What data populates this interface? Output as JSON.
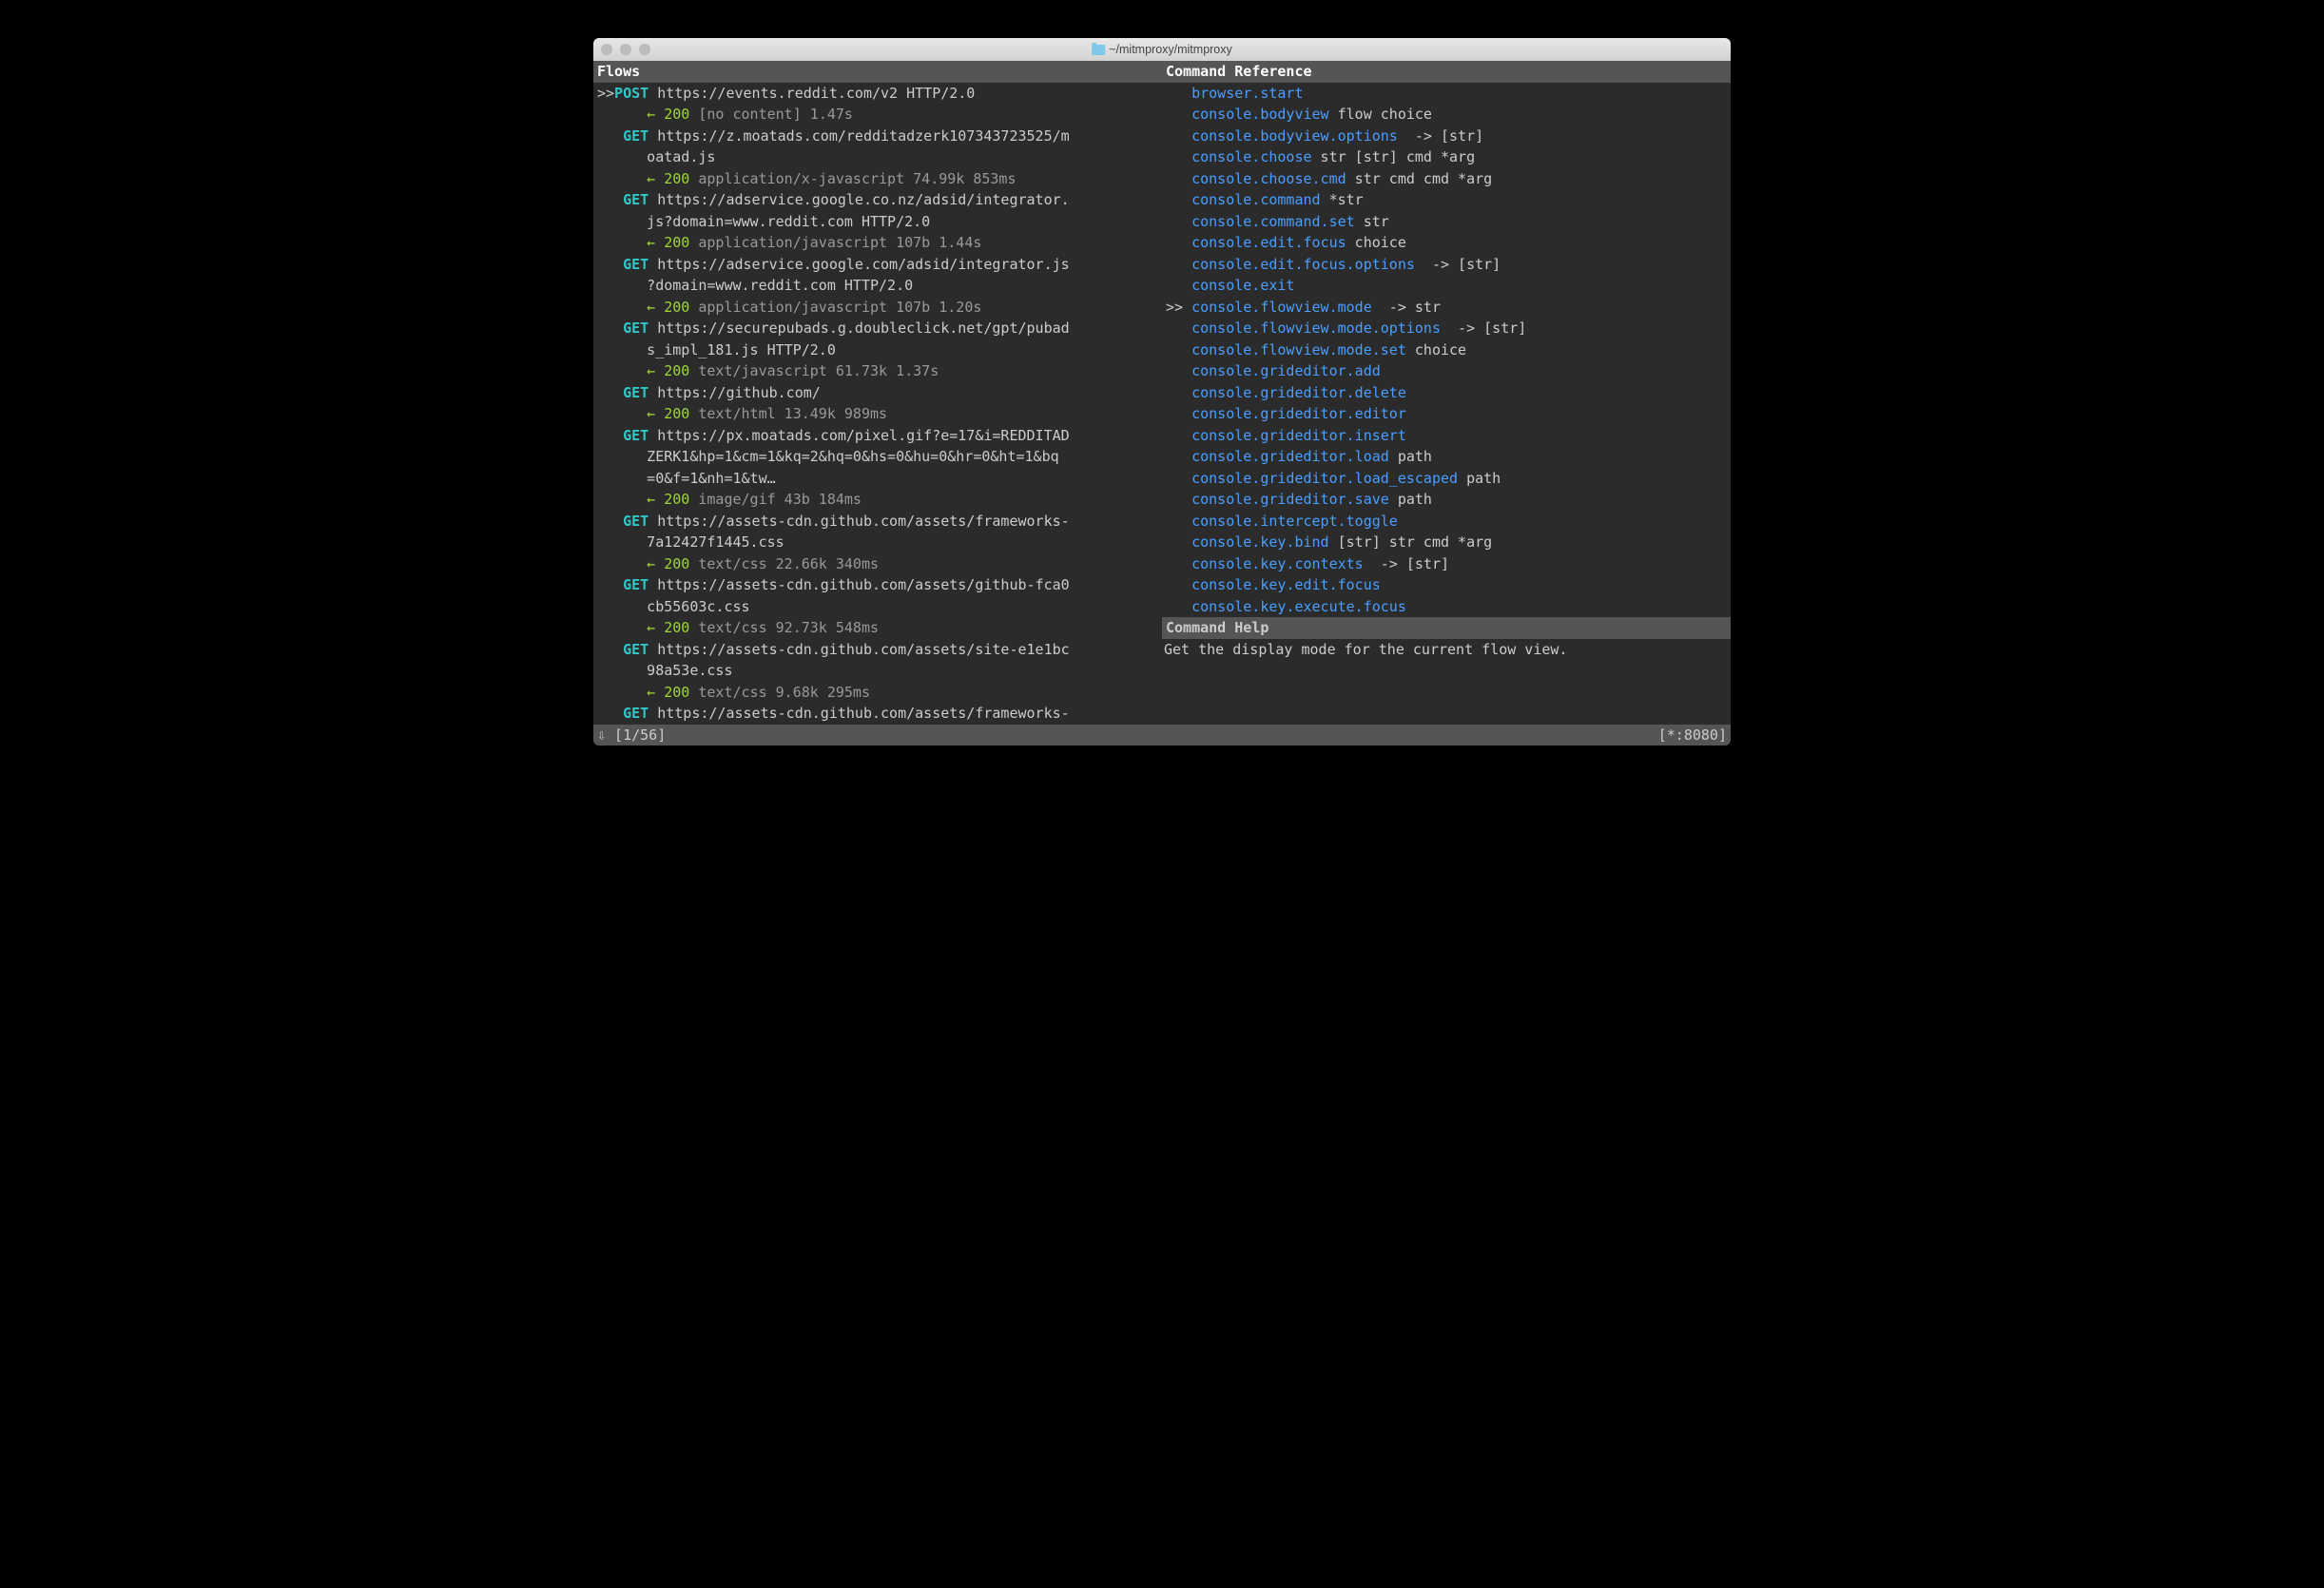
{
  "window": {
    "title": "~/mitmproxy/mitmproxy"
  },
  "panes": {
    "flows_header": "Flows",
    "commands_header": "Command Reference",
    "help_header": "Command Help",
    "help_text": "Get the display mode for the current flow view."
  },
  "flows": [
    {
      "selected": true,
      "method": "POST",
      "url": "https://events.reddit.com/v2 HTTP/2.0",
      "url_cont": [],
      "status": "200",
      "resp": "[no content] 1.47s"
    },
    {
      "selected": false,
      "method": "GET",
      "url": "https://z.moatads.com/redditadzerk107343723525/m",
      "url_cont": [
        "oatad.js"
      ],
      "status": "200",
      "resp": "application/x-javascript 74.99k 853ms"
    },
    {
      "selected": false,
      "method": "GET",
      "url": "https://adservice.google.co.nz/adsid/integrator.",
      "url_cont": [
        "js?domain=www.reddit.com HTTP/2.0"
      ],
      "status": "200",
      "resp": "application/javascript 107b 1.44s"
    },
    {
      "selected": false,
      "method": "GET",
      "url": "https://adservice.google.com/adsid/integrator.js",
      "url_cont": [
        "?domain=www.reddit.com HTTP/2.0"
      ],
      "status": "200",
      "resp": "application/javascript 107b 1.20s"
    },
    {
      "selected": false,
      "method": "GET",
      "url": "https://securepubads.g.doubleclick.net/gpt/pubad",
      "url_cont": [
        "s_impl_181.js HTTP/2.0"
      ],
      "status": "200",
      "resp": "text/javascript 61.73k 1.37s"
    },
    {
      "selected": false,
      "method": "GET",
      "url": "https://github.com/",
      "url_cont": [],
      "status": "200",
      "resp": "text/html 13.49k 989ms"
    },
    {
      "selected": false,
      "method": "GET",
      "url": "https://px.moatads.com/pixel.gif?e=17&i=REDDITAD",
      "url_cont": [
        "ZERK1&hp=1&cm=1&kq=2&hq=0&hs=0&hu=0&hr=0&ht=1&bq",
        "=0&f=1&nh=1&tw…"
      ],
      "status": "200",
      "resp": "image/gif 43b 184ms"
    },
    {
      "selected": false,
      "method": "GET",
      "url": "https://assets-cdn.github.com/assets/frameworks-",
      "url_cont": [
        "7a12427f1445.css"
      ],
      "status": "200",
      "resp": "text/css 22.66k 340ms"
    },
    {
      "selected": false,
      "method": "GET",
      "url": "https://assets-cdn.github.com/assets/github-fca0",
      "url_cont": [
        "cb55603c.css"
      ],
      "status": "200",
      "resp": "text/css 92.73k 548ms"
    },
    {
      "selected": false,
      "method": "GET",
      "url": "https://assets-cdn.github.com/assets/site-e1e1bc",
      "url_cont": [
        "98a53e.css"
      ],
      "status": "200",
      "resp": "text/css 9.68k 295ms"
    },
    {
      "selected": false,
      "method": "GET",
      "url": "https://assets-cdn.github.com/assets/frameworks-",
      "url_cont": [],
      "status": "",
      "resp": ""
    }
  ],
  "commands": [
    {
      "selected": false,
      "name": "browser.start",
      "args": ""
    },
    {
      "selected": false,
      "name": "console.bodyview",
      "args": " flow choice"
    },
    {
      "selected": false,
      "name": "console.bodyview.options",
      "args": "  -> [str]"
    },
    {
      "selected": false,
      "name": "console.choose",
      "args": " str [str] cmd *arg"
    },
    {
      "selected": false,
      "name": "console.choose.cmd",
      "args": " str cmd cmd *arg"
    },
    {
      "selected": false,
      "name": "console.command",
      "args": " *str"
    },
    {
      "selected": false,
      "name": "console.command.set",
      "args": " str"
    },
    {
      "selected": false,
      "name": "console.edit.focus",
      "args": " choice"
    },
    {
      "selected": false,
      "name": "console.edit.focus.options",
      "args": "  -> [str]"
    },
    {
      "selected": false,
      "name": "console.exit",
      "args": ""
    },
    {
      "selected": true,
      "name": "console.flowview.mode",
      "args": "  -> str"
    },
    {
      "selected": false,
      "name": "console.flowview.mode.options",
      "args": "  -> [str]"
    },
    {
      "selected": false,
      "name": "console.flowview.mode.set",
      "args": " choice"
    },
    {
      "selected": false,
      "name": "console.grideditor.add",
      "args": ""
    },
    {
      "selected": false,
      "name": "console.grideditor.delete",
      "args": ""
    },
    {
      "selected": false,
      "name": "console.grideditor.editor",
      "args": ""
    },
    {
      "selected": false,
      "name": "console.grideditor.insert",
      "args": ""
    },
    {
      "selected": false,
      "name": "console.grideditor.load",
      "args": " path"
    },
    {
      "selected": false,
      "name": "console.grideditor.load_escaped",
      "args": " path"
    },
    {
      "selected": false,
      "name": "console.grideditor.save",
      "args": " path"
    },
    {
      "selected": false,
      "name": "console.intercept.toggle",
      "args": ""
    },
    {
      "selected": false,
      "name": "console.key.bind",
      "args": " [str] str cmd *arg"
    },
    {
      "selected": false,
      "name": "console.key.contexts",
      "args": "  -> [str]"
    },
    {
      "selected": false,
      "name": "console.key.edit.focus",
      "args": ""
    },
    {
      "selected": false,
      "name": "console.key.execute.focus",
      "args": ""
    }
  ],
  "statusbar": {
    "left": "⇩ [1/56]",
    "right": "[*:8080]"
  }
}
